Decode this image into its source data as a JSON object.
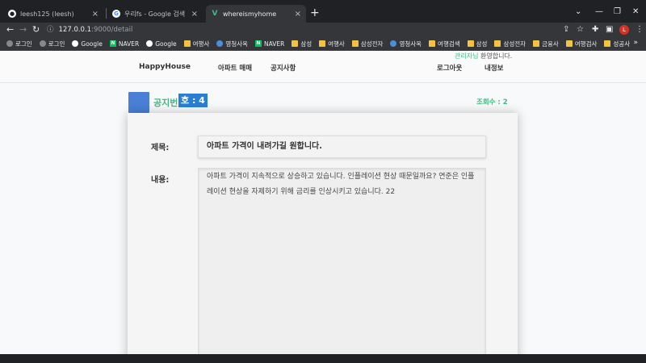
{
  "browser": {
    "tabs": [
      {
        "label": "leesh125 (leesh)",
        "icon": "github-icon"
      },
      {
        "label": "우리fs - Google 검색",
        "icon": "google-icon"
      },
      {
        "label": "whereismyhome",
        "icon": "vue-icon",
        "active": true
      }
    ],
    "url_host": "127.0.0.1",
    "url_path": ":9000/detail",
    "bookmarks": [
      {
        "label": "로그인",
        "icon": "wave"
      },
      {
        "label": "로그인",
        "icon": "wave"
      },
      {
        "label": "Google",
        "icon": "google"
      },
      {
        "label": "NAVER",
        "icon": "naver"
      },
      {
        "label": "Google",
        "icon": "google"
      },
      {
        "label": "여행사",
        "icon": "folder"
      },
      {
        "label": "영청사옥",
        "icon": "globe"
      },
      {
        "label": "NAVER",
        "icon": "naver"
      },
      {
        "label": "삼성",
        "icon": "folder"
      },
      {
        "label": "여행사",
        "icon": "folder"
      },
      {
        "label": "삼성전자",
        "icon": "folder"
      },
      {
        "label": "영청사옥",
        "icon": "globe"
      },
      {
        "label": "여행검색",
        "icon": "folder"
      },
      {
        "label": "삼성",
        "icon": "folder"
      },
      {
        "label": "삼성전자",
        "icon": "folder"
      },
      {
        "label": "금융사",
        "icon": "folder"
      },
      {
        "label": "여행검사",
        "icon": "folder"
      },
      {
        "label": "성공사",
        "icon": "folder"
      }
    ],
    "profile_initial": "L"
  },
  "navbar": {
    "brand": "HappyHouse",
    "links": [
      "아파트 매매",
      "공지사항"
    ],
    "logout": "로그아웃",
    "myinfo": "내정보",
    "welcome_user": "관리자님",
    "welcome_text": " 환영합니다."
  },
  "notice": {
    "label": "공지번",
    "number_text": "호 : 4",
    "views": "조회수 : 2"
  },
  "detail": {
    "title_label": "제목:",
    "title": "아파트 가격이 내려가길 원합니다.",
    "content_label": "내용:",
    "content": "아파트 가격이 지속적으로 상승하고 있습니다. 인플레이션 현상 때문일까요? 연준은 인플레이션 현상을 자제하기 위해 금리를 인상시키고 있습니다. 22"
  },
  "colors": {
    "accent": "#42b983",
    "badge": "#2a7fd4",
    "chrome_dark": "#202124",
    "chrome_mid": "#35363a"
  }
}
